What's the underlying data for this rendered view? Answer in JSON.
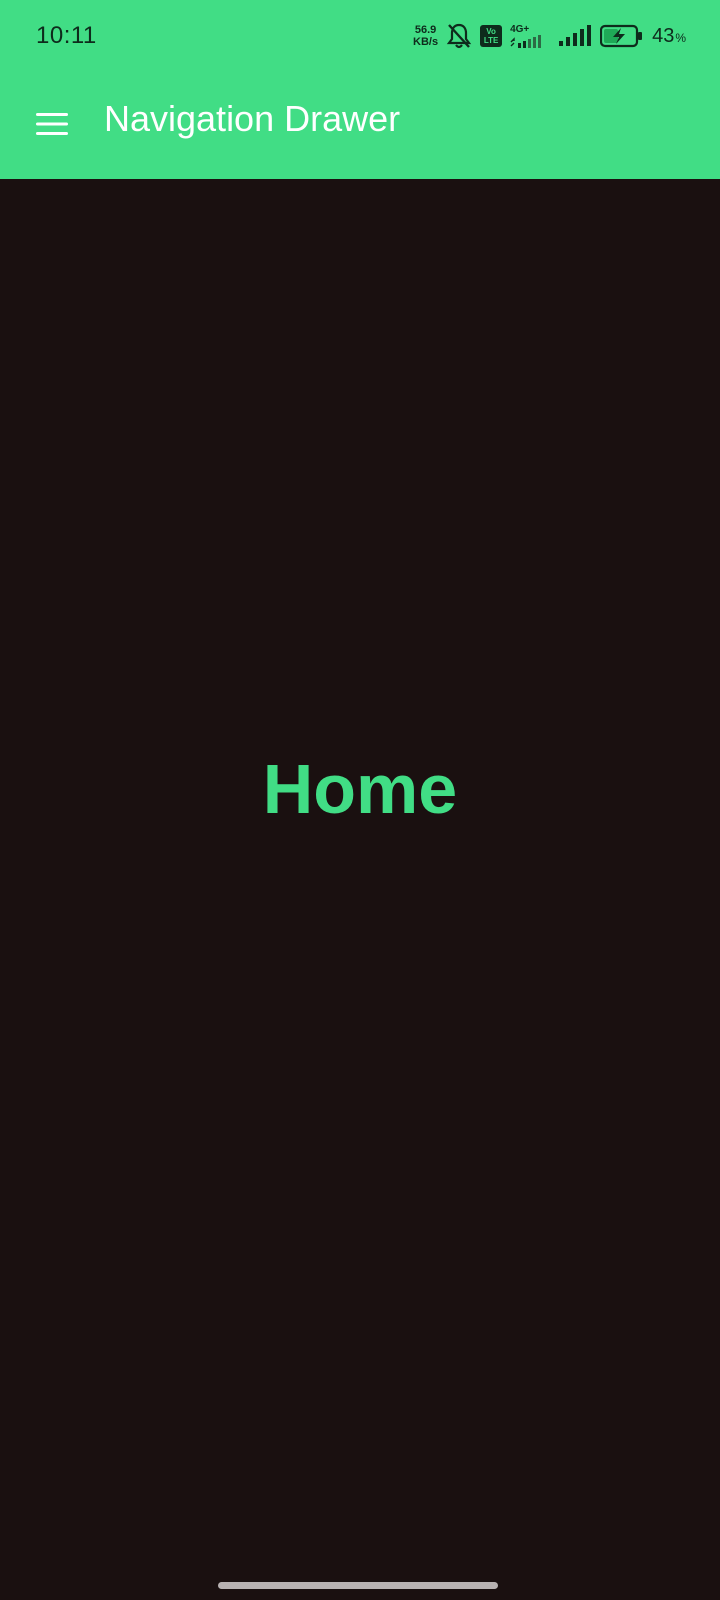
{
  "status_bar": {
    "time": "10:11",
    "speed_value": "56.9",
    "speed_unit": "KB/s",
    "volte_top": "Vo",
    "volte_bottom": "LTE",
    "network_type": "4G+",
    "battery_level": "43",
    "battery_unit": "%",
    "icons": [
      "bell-muted-icon",
      "volte-icon",
      "signal-icon",
      "signal-icon",
      "battery-charging-icon"
    ]
  },
  "app_bar": {
    "title": "Navigation Drawer",
    "menu_icon": "hamburger-menu-icon"
  },
  "content": {
    "label": "Home"
  },
  "colors": {
    "accent": "#41dd85",
    "background": "#1a1010",
    "title_text": "#ffffff",
    "status_text": "#0e2b1c"
  }
}
